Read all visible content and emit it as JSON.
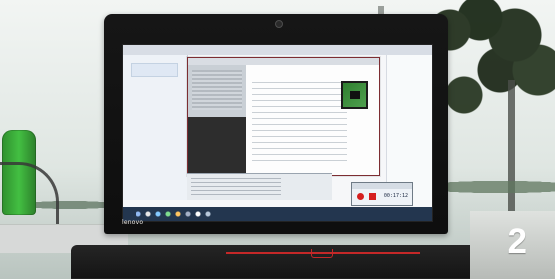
{
  "scene": {
    "overlay_number": "2",
    "laptop_brand": "lenovo"
  },
  "screen": {
    "recorder_time": "00:17:12"
  }
}
